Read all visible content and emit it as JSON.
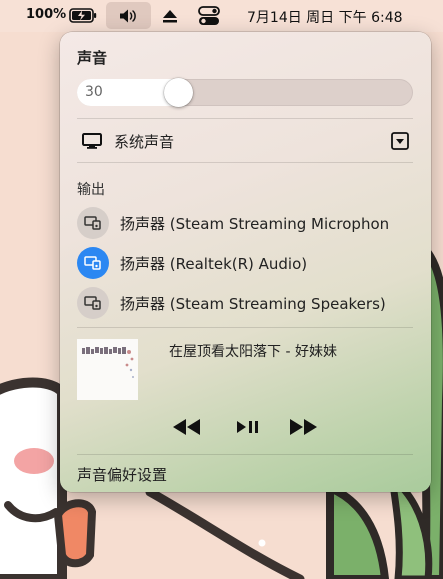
{
  "menubar": {
    "battery_percent": "100%",
    "datetime": "7月14日 周日 下午 6:48",
    "icons": [
      "battery-charging-icon",
      "volume-icon",
      "eject-icon",
      "control-center-icon"
    ]
  },
  "sound_panel": {
    "title": "声音",
    "volume": {
      "value": "30",
      "level_percent": 30
    },
    "system_sound_label": "系统声音",
    "output_section_label": "输出",
    "output_devices": [
      {
        "label": "扬声器 (Steam Streaming Microphon",
        "active": false
      },
      {
        "label": "扬声器 (Realtek(R) Audio)",
        "active": true
      },
      {
        "label": "扬声器 (Steam Streaming Speakers)",
        "active": false
      }
    ],
    "now_playing": {
      "title": "在屋顶看太阳落下 - 好妹妹"
    },
    "controls": [
      "rewind-icon",
      "play-pause-icon",
      "fast-forward-icon"
    ],
    "preferences_label": "声音偏好设置"
  },
  "colors": {
    "accent": "#2b87f2",
    "wallpaper": "#f6ddd0"
  }
}
